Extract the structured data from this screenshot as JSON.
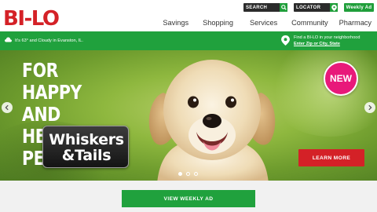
{
  "brand": {
    "logo_text": "BI-LO",
    "accent_color": "#20a13d",
    "logo_color": "#d42127"
  },
  "utility": {
    "search_label": "SEARCH",
    "search_icon": "search-icon",
    "locator_label": "LOCATOR",
    "locator_icon": "location-pin-icon",
    "weekly_ad_label": "Weekly Ad"
  },
  "nav": {
    "items": [
      {
        "label": "Savings"
      },
      {
        "label": "Shopping"
      },
      {
        "label": "Services"
      },
      {
        "label": "Community"
      },
      {
        "label": "Pharmacy"
      }
    ]
  },
  "infobar": {
    "weather_text": "It's 63° and Cloudy in Evanston, IL.",
    "weather_icon": "cloud-icon",
    "finder_text": "Find a BI-LO in your neighborhood",
    "finder_link": "Enter Zip or City, State",
    "finder_icon": "location-pin-icon"
  },
  "hero": {
    "headline_line1": "FOR HAPPY AND",
    "headline_line2": "HEALTHY PETS",
    "brand_line1": "Whiskers",
    "brand_line2": "&Tails",
    "badge": "NEW",
    "badge_color": "#e8197a",
    "cta_label": "LEARN MORE",
    "cta_color": "#d42127",
    "slides_total": 3,
    "active_slide": 1
  },
  "footer": {
    "weekly_ad_button": "VIEW WEEKLY AD"
  }
}
